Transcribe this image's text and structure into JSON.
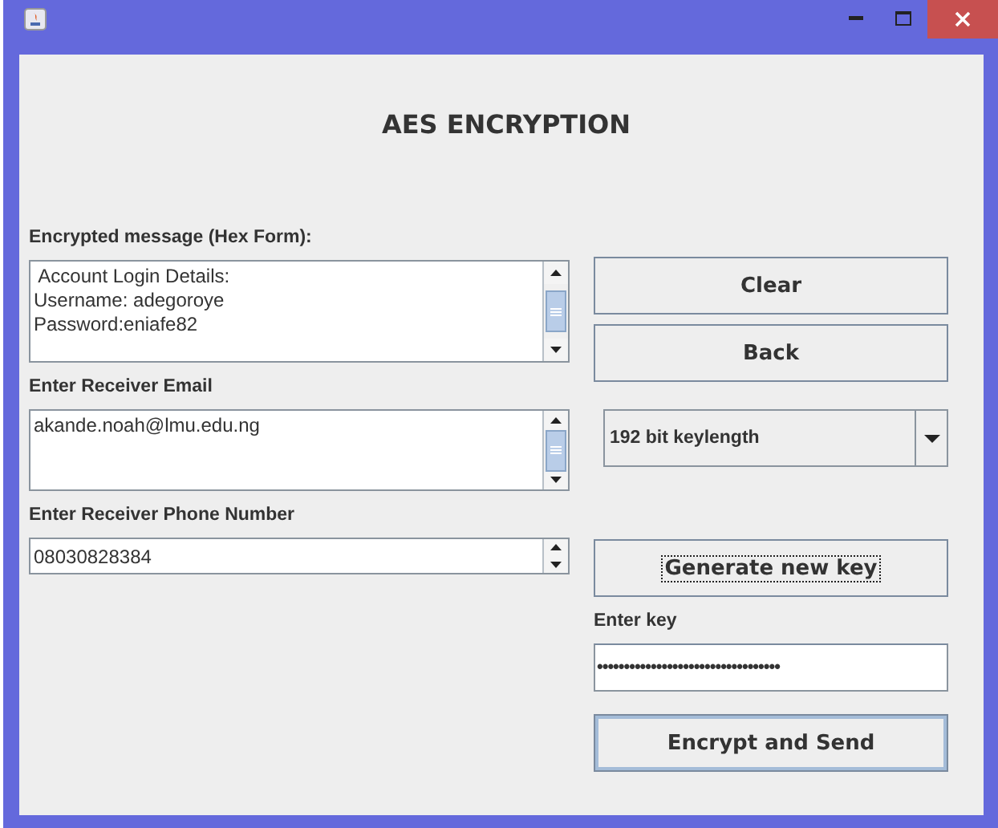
{
  "window": {
    "title": "AES ENCRYPTION"
  },
  "message": {
    "label": "Encrypted message (Hex Form):",
    "lines": [
      " Account Login Details:",
      "Username: adegoroye",
      "Password:eniafe82"
    ]
  },
  "email": {
    "label": "Enter Receiver Email",
    "lines": [
      "akande.noah@lmu.edu.ng"
    ]
  },
  "phone": {
    "label": "Enter Receiver Phone Number",
    "value": "08030828384"
  },
  "buttons": [
    {
      "label": "Clear"
    },
    {
      "label": "Back"
    }
  ],
  "keylength": {
    "value": "192 bit keylength"
  },
  "generate": {
    "label": "Generate new key",
    "focused": true
  },
  "key": {
    "label": "Enter key",
    "value": "••••••••••••••••••••••••••••••••••"
  },
  "send": {
    "label": "Encrypt and Send",
    "default": true
  }
}
